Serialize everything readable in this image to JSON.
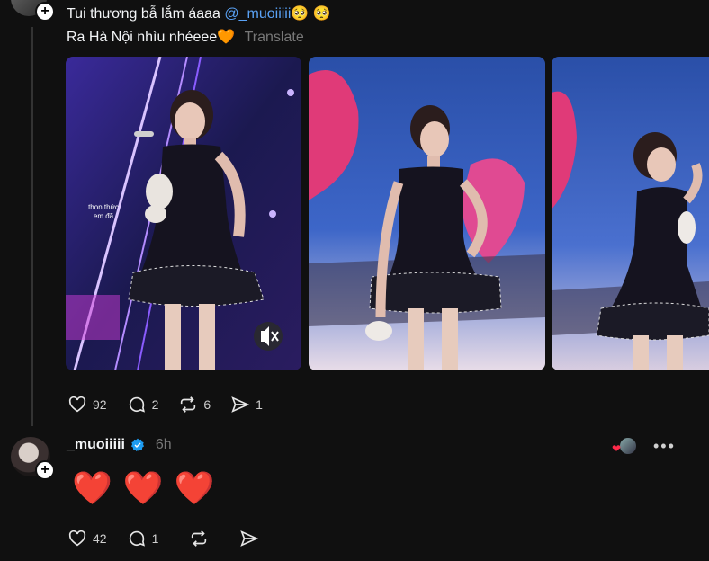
{
  "post": {
    "line1_text": "Tui thương bẫ lắm áaaa ",
    "mention": "@_muoiiiii",
    "line1_emoji": "🥺 🥺",
    "line2_text": "Ra Hà Nội nhìu nhéeee",
    "line2_emoji": "🧡",
    "translate": "Translate",
    "image1_caption": "thon thức em đã",
    "actions": {
      "likes": "92",
      "comments": "2",
      "reposts": "6",
      "shares": "1"
    }
  },
  "reply": {
    "username": "_muoiiiii",
    "time": "6h",
    "content_emoji": [
      "❤️",
      "❤️",
      "❤️"
    ],
    "actions": {
      "likes": "42",
      "comments": "1"
    }
  },
  "colors": {
    "background": "#101010",
    "mention": "#5aa2f5",
    "muted": "#777777",
    "verified": "#1d9bf0"
  }
}
